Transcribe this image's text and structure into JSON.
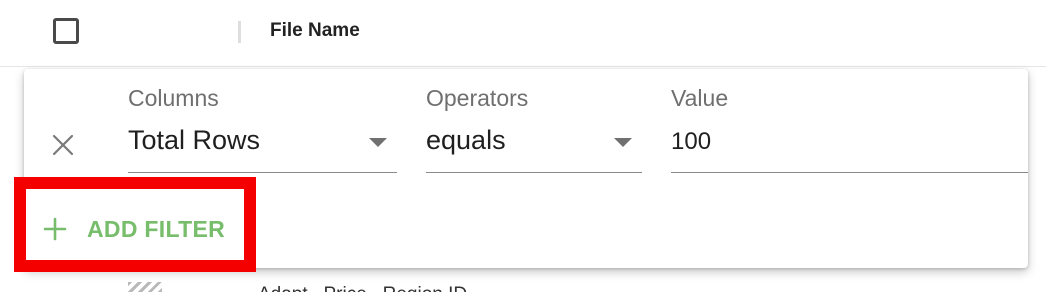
{
  "table": {
    "header": {
      "file_name_label": "File Name"
    },
    "background_row": {
      "partial_text": "Adapt...Price...Region ID"
    }
  },
  "filter_panel": {
    "columns_label": "Columns",
    "operators_label": "Operators",
    "value_label": "Value",
    "column_selected": "Total Rows",
    "operator_selected": "equals",
    "value": "100",
    "add_filter_label": "ADD FILTER",
    "icons": {
      "remove": "close-icon",
      "add": "plus-icon",
      "dropdown": "triangle-down-icon"
    }
  },
  "colors": {
    "accent_green": "#77bd6b",
    "highlight_red": "#f40000",
    "label_gray": "#6f6f6f"
  }
}
